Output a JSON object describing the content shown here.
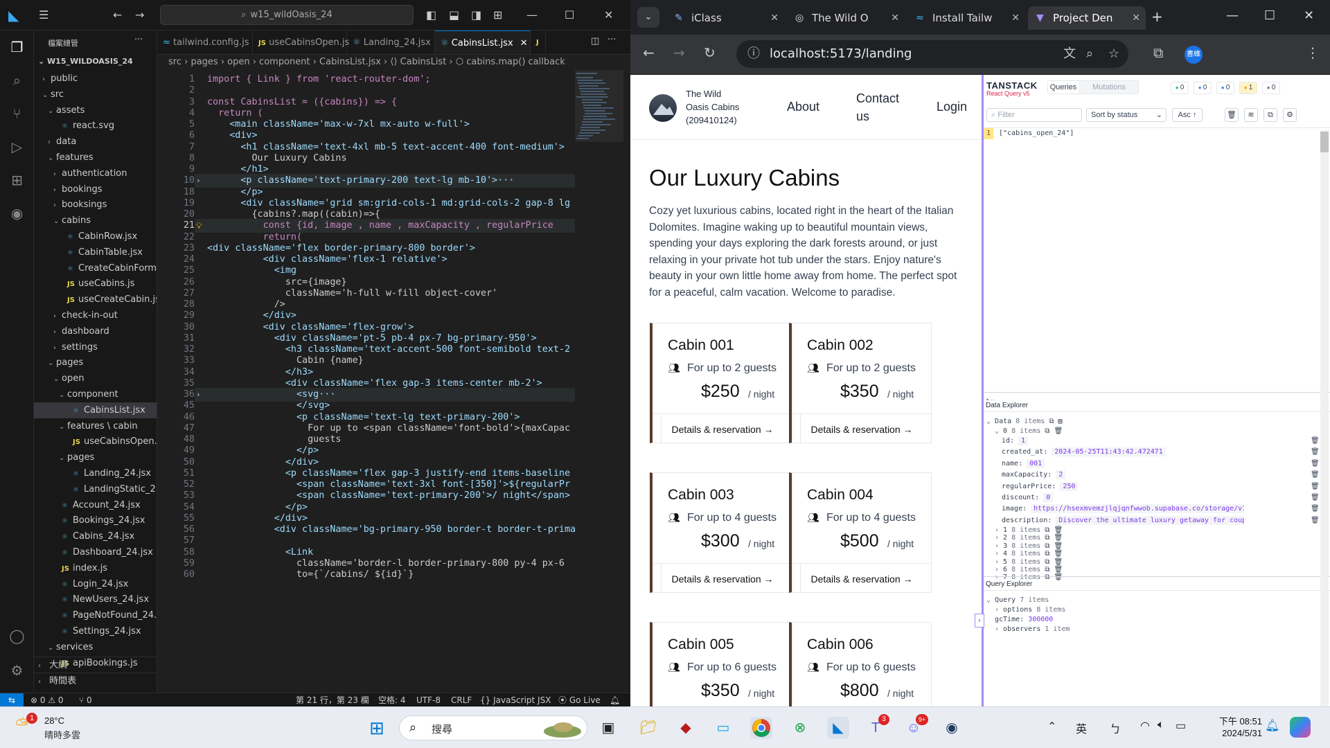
{
  "vscode": {
    "search": "w15_wildOasis_24",
    "explorer_title": "檔案總管",
    "workspace": "W15_WILDOASIS_24",
    "tree": [
      {
        "label": "public",
        "depth": 1,
        "type": "folder",
        "open": false
      },
      {
        "label": "src",
        "depth": 1,
        "type": "folder",
        "open": true
      },
      {
        "label": "assets",
        "depth": 2,
        "type": "folder",
        "open": true
      },
      {
        "label": "react.svg",
        "depth": 3,
        "type": "file"
      },
      {
        "label": "data",
        "depth": 2,
        "type": "folder",
        "open": false
      },
      {
        "label": "features",
        "depth": 2,
        "type": "folder",
        "open": true
      },
      {
        "label": "authentication",
        "depth": 3,
        "type": "folder",
        "open": false
      },
      {
        "label": "bookings",
        "depth": 3,
        "type": "folder",
        "open": false
      },
      {
        "label": "booksings",
        "depth": 3,
        "type": "folder",
        "open": false
      },
      {
        "label": "cabins",
        "depth": 3,
        "type": "folder",
        "open": true
      },
      {
        "label": "CabinRow.jsx",
        "depth": 4,
        "type": "jsx"
      },
      {
        "label": "CabinTable.jsx",
        "depth": 4,
        "type": "jsx"
      },
      {
        "label": "CreateCabinForm...",
        "depth": 4,
        "type": "jsx"
      },
      {
        "label": "useCabins.js",
        "depth": 4,
        "type": "js"
      },
      {
        "label": "useCreateCabin.js",
        "depth": 4,
        "type": "js"
      },
      {
        "label": "check-in-out",
        "depth": 3,
        "type": "folder",
        "open": false
      },
      {
        "label": "dashboard",
        "depth": 3,
        "type": "folder",
        "open": false
      },
      {
        "label": "settings",
        "depth": 3,
        "type": "folder",
        "open": false
      },
      {
        "label": "pages",
        "depth": 2,
        "type": "folder",
        "open": true
      },
      {
        "label": "open",
        "depth": 3,
        "type": "folder",
        "open": true
      },
      {
        "label": "component",
        "depth": 4,
        "type": "folder",
        "open": true
      },
      {
        "label": "CabinsList.jsx",
        "depth": 5,
        "type": "jsx",
        "selected": true
      },
      {
        "label": "features \\ cabin",
        "depth": 4,
        "type": "folder",
        "open": true
      },
      {
        "label": "useCabinsOpen.js",
        "depth": 5,
        "type": "js"
      },
      {
        "label": "pages",
        "depth": 4,
        "type": "folder",
        "open": true
      },
      {
        "label": "Landing_24.jsx",
        "depth": 5,
        "type": "jsx"
      },
      {
        "label": "LandingStatic_2...",
        "depth": 5,
        "type": "jsx"
      },
      {
        "label": "Account_24.jsx",
        "depth": 3,
        "type": "jsx"
      },
      {
        "label": "Bookings_24.jsx",
        "depth": 3,
        "type": "jsx"
      },
      {
        "label": "Cabins_24.jsx",
        "depth": 3,
        "type": "jsx"
      },
      {
        "label": "Dashboard_24.jsx",
        "depth": 3,
        "type": "jsx"
      },
      {
        "label": "index.js",
        "depth": 3,
        "type": "js"
      },
      {
        "label": "Login_24.jsx",
        "depth": 3,
        "type": "jsx"
      },
      {
        "label": "NewUsers_24.jsx",
        "depth": 3,
        "type": "jsx"
      },
      {
        "label": "PageNotFound_24....",
        "depth": 3,
        "type": "jsx"
      },
      {
        "label": "Settings_24.jsx",
        "depth": 3,
        "type": "jsx"
      },
      {
        "label": "services",
        "depth": 2,
        "type": "folder",
        "open": true
      },
      {
        "label": "apiBookings.js",
        "depth": 3,
        "type": "js"
      }
    ],
    "outline": "大綱",
    "timeline": "時間表",
    "tabs": [
      "tailwind.config.js",
      "useCabinsOpen.js",
      "Landing_24.jsx",
      "CabinsList.jsx",
      "J"
    ],
    "breadcrumb": "src › pages › open › component › CabinsList.jsx › ⟨⟩ CabinsList › ⬡ cabins.map() callback",
    "lines": [
      {
        "n": "1",
        "t": "import { Link } from 'react-router-dom';"
      },
      {
        "n": "2",
        "t": ""
      },
      {
        "n": "3",
        "t": "const CabinsList = ({cabins}) => {"
      },
      {
        "n": "4",
        "t": "  return ("
      },
      {
        "n": "5",
        "t": "    <main className='max-w-7xl mx-auto w-full'>"
      },
      {
        "n": "6",
        "t": "    <div>"
      },
      {
        "n": "7",
        "t": "      <h1 className='text-4xl mb-5 text-accent-400 font-medium'>"
      },
      {
        "n": "8",
        "t": "        Our Luxury Cabins"
      },
      {
        "n": "9",
        "t": "      </h1>"
      },
      {
        "n": "10",
        "t": "      <p className='text-primary-200 text-lg mb-10'>···"
      },
      {
        "n": "18",
        "t": "      </p>"
      },
      {
        "n": "19",
        "t": "      <div className='grid sm:grid-cols-1 md:grid-cols-2 gap-8 lg"
      },
      {
        "n": "20",
        "t": "        {cabins?.map((cabin)=>{"
      },
      {
        "n": "21",
        "t": "          const {id, image , name , maxCapacity , regularPrice"
      },
      {
        "n": "22",
        "t": "          return("
      },
      {
        "n": "23",
        "t": "<div className='flex border-primary-800 border'>"
      },
      {
        "n": "24",
        "t": "          <div className='flex-1 relative'>"
      },
      {
        "n": "25",
        "t": "            <img"
      },
      {
        "n": "26",
        "t": "              src={image}"
      },
      {
        "n": "27",
        "t": "              className='h-full w-fill object-cover'"
      },
      {
        "n": "28",
        "t": "            />"
      },
      {
        "n": "29",
        "t": "          </div>"
      },
      {
        "n": "30",
        "t": "          <div className='flex-grow'>"
      },
      {
        "n": "31",
        "t": "            <div className='pt-5 pb-4 px-7 bg-primary-950'>"
      },
      {
        "n": "32",
        "t": "              <h3 className='text-accent-500 font-semibold text-2"
      },
      {
        "n": "33",
        "t": "                Cabin {name}"
      },
      {
        "n": "34",
        "t": "              </h3>"
      },
      {
        "n": "35",
        "t": "              <div className='flex gap-3 items-center mb-2'>"
      },
      {
        "n": "36",
        "t": "                <svg···"
      },
      {
        "n": "45",
        "t": "                </svg>"
      },
      {
        "n": "46",
        "t": "                <p className='text-lg text-primary-200'>"
      },
      {
        "n": "47",
        "t": "                  For up to <span className='font-bold'>{maxCapac"
      },
      {
        "n": "48",
        "t": "                  guests"
      },
      {
        "n": "49",
        "t": "                </p>"
      },
      {
        "n": "50",
        "t": "              </div>"
      },
      {
        "n": "51",
        "t": "              <p className='flex gap-3 justify-end items-baseline"
      },
      {
        "n": "52",
        "t": "                <span className='text-3xl font-[350]'>${regularPr"
      },
      {
        "n": "53",
        "t": "                <span className='text-primary-200'>/ night</span>"
      },
      {
        "n": "54",
        "t": "              </p>"
      },
      {
        "n": "55",
        "t": "            </div>"
      },
      {
        "n": "56",
        "t": "            <div className='bg-primary-950 border-t border-t-prima"
      },
      {
        "n": "57",
        "t": ""
      },
      {
        "n": "58",
        "t": "              <Link"
      },
      {
        "n": "59",
        "t": "                className='border-l border-primary-800 py-4 px-6"
      },
      {
        "n": "60",
        "t": "                to={`/cabins/ ${id}`}"
      }
    ],
    "status": {
      "errors": "⊗ 0 ⚠ 0",
      "ports": "⑂ 0",
      "position": "第 21 行，第 23 欄",
      "spaces": "空格: 4",
      "encoding": "UTF-8",
      "eol": "CRLF",
      "lang": "{} JavaScript JSX",
      "golive": "Go Live"
    }
  },
  "chrome": {
    "tabs": [
      "iClass",
      "The Wild O",
      "Install Tailw",
      "Project Den"
    ],
    "url": "localhost:5173/landing",
    "profile": "書維"
  },
  "site": {
    "brand_line1": "The Wild",
    "brand_line2": "Oasis Cabins",
    "brand_line3": "(209410124)",
    "nav": [
      "About",
      "Contact",
      "us",
      "Login"
    ],
    "title": "Our Luxury Cabins",
    "intro": "Cozy yet luxurious cabins, located right in the heart of the Italian Dolomites. Imagine waking up to beautiful mountain views, spending your days exploring the dark forests around, or just relaxing in your private hot tub under the stars. Enjoy nature's beauty in your own little home away from home. The perfect spot for a peaceful, calm vacation. Welcome to paradise.",
    "cabins": [
      {
        "name": "Cabin 001",
        "guests": "For up to 2 guests",
        "price": "$250",
        "per": "/ night",
        "link": "Details & reservation →"
      },
      {
        "name": "Cabin 002",
        "guests": "For up to 2 guests",
        "price": "$350",
        "per": "/ night",
        "link": "Details & reservation →"
      },
      {
        "name": "Cabin 003",
        "guests": "For up to 4 guests",
        "price": "$300",
        "per": "/ night",
        "link": "Details & reservation →"
      },
      {
        "name": "Cabin 004",
        "guests": "For up to 4 guests",
        "price": "$500",
        "per": "/ night",
        "link": "Details & reservation →"
      },
      {
        "name": "Cabin 005",
        "guests": "For up to 6 guests",
        "price": "$350",
        "per": "/ night",
        "link": "Details & reservation →"
      },
      {
        "name": "Cabin 006",
        "guests": "For up to 6 guests",
        "price": "$800",
        "per": "/ night",
        "link": "Details & reservation →"
      }
    ]
  },
  "tanstack": {
    "title": "TANSTACK",
    "subtitle": "React Query v5",
    "tab_queries": "Queries",
    "tab_mutations": "Mutations",
    "counts": [
      "0",
      "0",
      "0",
      "1",
      "0"
    ],
    "filter_placeholder": "Filter",
    "sort": "Sort by status",
    "order": "Asc ↑",
    "query_count": "1",
    "query_key": "[\"cabins_open_24\"]",
    "data_explorer": "Data Explorer",
    "data_label": "Data",
    "data_count": "8 items",
    "item0": "0",
    "item0_count": "8 items",
    "fields": [
      {
        "k": "id:",
        "v": "1"
      },
      {
        "k": "created_at:",
        "v": "2024-05-25T11:43:42.472471"
      },
      {
        "k": "name:",
        "v": "001"
      },
      {
        "k": "maxCapacity:",
        "v": "2"
      },
      {
        "k": "regularPrice:",
        "v": "250"
      },
      {
        "k": "discount:",
        "v": "0"
      },
      {
        "k": "image:",
        "v": "https://hsexmvemzjlqjqnfwwob.supabase.co/storage/v1/object/public/ca"
      },
      {
        "k": "description:",
        "v": "Discover the ultimate luxury getaway for couples in the cozy w"
      }
    ],
    "collapsed_items": [
      "1",
      "2",
      "3",
      "4",
      "5",
      "6",
      "7"
    ],
    "collapsed_count": "8 items",
    "query_explorer": "Query Explorer",
    "query_label": "Query",
    "query_items": "7 items",
    "options": "options",
    "options_count": "8 items",
    "gctime_k": "gcTime:",
    "gctime_v": "300000",
    "observers": "observers",
    "observers_count": "1 item"
  },
  "taskbar": {
    "temp": "28°C",
    "weather": "晴時多雲",
    "weather_badge": "1",
    "search": "搜尋",
    "ime1": "英",
    "ime2": "ㄅ",
    "time": "下午 08:51",
    "date": "2024/5/31",
    "teams_badge": "3",
    "discord_badge": "9+"
  }
}
